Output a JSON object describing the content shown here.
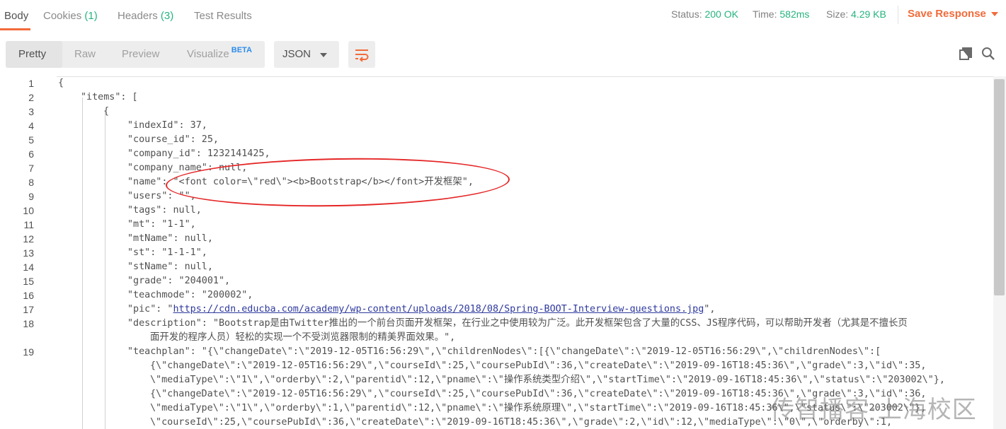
{
  "tabs": [
    {
      "label": "Body",
      "count": ""
    },
    {
      "label": "Cookies",
      "count": "(1)"
    },
    {
      "label": "Headers",
      "count": "(3)"
    },
    {
      "label": "Test Results",
      "count": ""
    }
  ],
  "status": {
    "status_label": "Status:",
    "status_value": "200 OK",
    "time_label": "Time:",
    "time_value": "582ms",
    "size_label": "Size:",
    "size_value": "4.29 KB"
  },
  "save_response_label": "Save Response",
  "view_modes": [
    "Pretty",
    "Raw",
    "Preview",
    "Visualize"
  ],
  "beta_label": "BETA",
  "format": "JSON",
  "colors": {
    "accent": "#f26b3a",
    "status_ok": "#26b47f",
    "annotation": "#e52626"
  },
  "icons": [
    "wrap-lines-icon",
    "copy-icon",
    "search-icon",
    "chevron-down-icon"
  ],
  "code_lines": [
    {
      "n": "1",
      "text": "{"
    },
    {
      "n": "2",
      "text": "\"items\": ["
    },
    {
      "n": "3",
      "text": "{"
    },
    {
      "n": "4",
      "text": "\"indexId\": 37,"
    },
    {
      "n": "5",
      "text": "\"course_id\": 25,"
    },
    {
      "n": "6",
      "text": "\"company_id\": 1232141425,"
    },
    {
      "n": "7",
      "text": "\"company_name\": null,"
    },
    {
      "n": "8",
      "text": "\"name\": \"<font color=\\\"red\\\"><b>Bootstrap</b></font>开发框架\","
    },
    {
      "n": "9",
      "text": "\"users\": \"\","
    },
    {
      "n": "10",
      "text": "\"tags\": null,"
    },
    {
      "n": "11",
      "text": "\"mt\": \"1-1\","
    },
    {
      "n": "12",
      "text": "\"mtName\": null,"
    },
    {
      "n": "13",
      "text": "\"st\": \"1-1-1\","
    },
    {
      "n": "14",
      "text": "\"stName\": null,"
    },
    {
      "n": "15",
      "text": "\"grade\": \"204001\","
    },
    {
      "n": "16",
      "text": "\"teachmode\": \"200002\","
    },
    {
      "n": "17",
      "text_key": "\"pic\": \"",
      "text_url": "https://cdn.educba.com/academy/wp-content/uploads/2018/08/Spring-BOOT-Interview-questions.jpg",
      "text_end": "\","
    },
    {
      "n": "18",
      "text": "\"description\": \"Bootstrap是由Twitter推出的一个前台页面开发框架，在行业之中使用较为广泛。此开发框架包含了大量的CSS、JS程序代码，可以帮助开发者（尤其是不擅长页",
      "text_cont": "面开发的程序人员）轻松的实现一个不受浏览器限制的精美界面效果。\","
    },
    {
      "n": "19",
      "text": "\"teachplan\": \"{\\\"changeDate\\\":\\\"2019-12-05T16:56:29\\\",\\\"childrenNodes\\\":[{\\\"changeDate\\\":\\\"2019-12-05T16:56:29\\\",\\\"childrenNodes\\\":[",
      "text_cont": [
        "{\\\"changeDate\\\":\\\"2019-12-05T16:56:29\\\",\\\"courseId\\\":25,\\\"coursePubId\\\":36,\\\"createDate\\\":\\\"2019-09-16T18:45:36\\\",\\\"grade\\\":3,\\\"id\\\":35,",
        "\\\"mediaType\\\":\\\"1\\\",\\\"orderby\\\":2,\\\"parentid\\\":12,\\\"pname\\\":\\\"操作系统类型介绍\\\",\\\"startTime\\\":\\\"2019-09-16T18:45:36\\\",\\\"status\\\":\\\"203002\\\"},",
        "{\\\"changeDate\\\":\\\"2019-12-05T16:56:29\\\",\\\"courseId\\\":25,\\\"coursePubId\\\":36,\\\"createDate\\\":\\\"2019-09-16T18:45:36\\\",\\\"grade\\\":3,\\\"id\\\":36,",
        "\\\"mediaType\\\":\\\"1\\\",\\\"orderby\\\":1,\\\"parentid\\\":12,\\\"pname\\\":\\\"操作系统原理\\\",\\\"startTime\\\":\\\"2019-09-16T18:45:36\\\",\\\"status\\\":\\\"203002\\\"},",
        "\\\"courseId\\\":25,\\\"coursePubId\\\":36,\\\"createDate\\\":\\\"2019-09-16T18:45:36\\\",\\\"grade\\\":2,\\\"id\\\":12,\\\"mediaType\\\":\\\"0\\\",\\\"orderby\\\":1,"
      ]
    }
  ],
  "watermark": "传智播客·上海校区"
}
